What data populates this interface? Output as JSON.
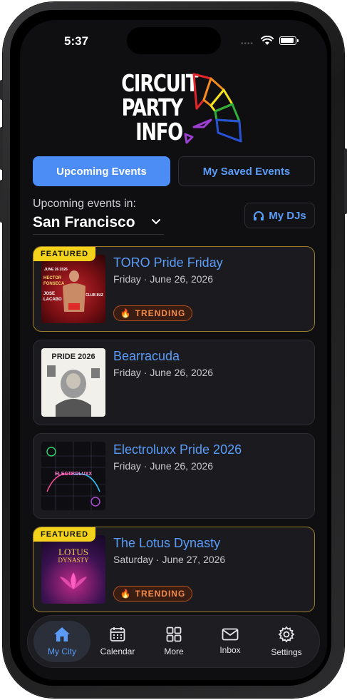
{
  "status_bar": {
    "time": "5:37",
    "dots": "••••"
  },
  "logo": {
    "line1": "CIRCUIT",
    "line2": "PARTY",
    "line3": "INFO"
  },
  "tabs": {
    "upcoming": "Upcoming Events",
    "saved": "My Saved Events"
  },
  "location": {
    "label": "Upcoming events in:",
    "city": "San Francisco"
  },
  "dj_button": {
    "label": "My DJs"
  },
  "badges": {
    "featured": "FEATURED",
    "trending": "TRENDING"
  },
  "events": [
    {
      "title": "TORO Pride Friday",
      "date": "Friday · June 26, 2026",
      "featured": true,
      "trending": true,
      "poster": {
        "line1": "JUNE 26 2026",
        "line2": "HECTOR",
        "line3": "FONSECA",
        "line4": "JOSE",
        "line5": "LACABO",
        "club": "CLUB 8UZ"
      }
    },
    {
      "title": "Bearracuda",
      "date": "Friday · June 26, 2026",
      "featured": false,
      "trending": false,
      "poster": {
        "line1": "PRIDE 2026"
      }
    },
    {
      "title": "Electroluxx Pride 2026",
      "date": "Friday · June 26, 2026",
      "featured": false,
      "trending": false,
      "poster": {
        "line1": "ELECTROLUXX"
      }
    },
    {
      "title": "The Lotus Dynasty",
      "date": "Saturday · June 27, 2026",
      "featured": true,
      "trending": true,
      "poster": {
        "line1": "LOTUS",
        "line2": "DYNASTY"
      }
    }
  ],
  "tabbar": [
    {
      "label": "My City",
      "icon": "home-icon",
      "active": true
    },
    {
      "label": "Calendar",
      "icon": "calendar-icon",
      "active": false
    },
    {
      "label": "More",
      "icon": "grid-icon",
      "active": false
    },
    {
      "label": "Inbox",
      "icon": "mail-icon",
      "active": false
    },
    {
      "label": "Settings",
      "icon": "gear-icon",
      "active": false
    }
  ],
  "colors": {
    "accent": "#4b8df5",
    "link": "#5a9cf8",
    "featured": "#f2d21a",
    "trending": "#f38a4a",
    "background": "#0f0f11"
  }
}
